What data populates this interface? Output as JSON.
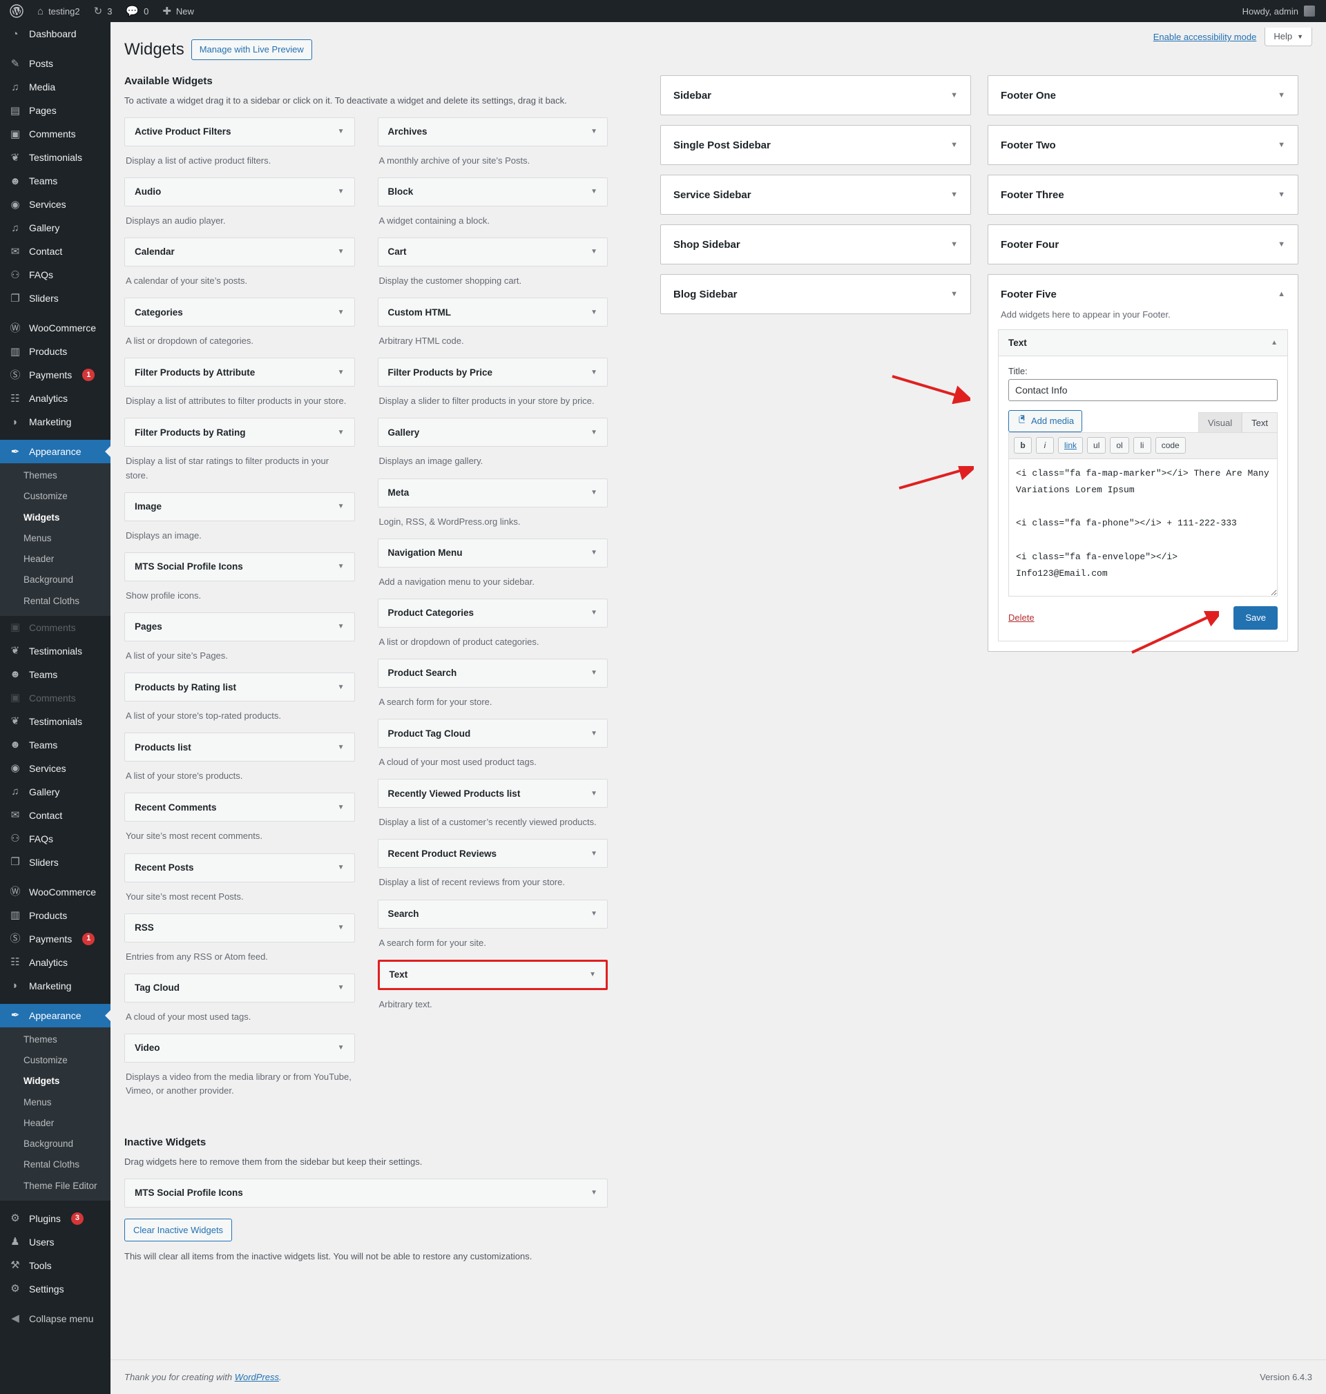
{
  "adminbar": {
    "wp_logo": "wordpress-logo",
    "site_name": "testing2",
    "updates_count": "3",
    "comments_count": "0",
    "new_label": "New",
    "howdy": "Howdy, admin"
  },
  "sidebar": {
    "groups": [
      {
        "items": [
          {
            "label": "Dashboard",
            "icon": "dashboard-icon"
          }
        ]
      },
      {
        "items": [
          {
            "label": "Posts",
            "icon": "pin-icon"
          },
          {
            "label": "Media",
            "icon": "media-icon"
          },
          {
            "label": "Pages",
            "icon": "pages-icon"
          },
          {
            "label": "Comments",
            "icon": "comment-icon"
          },
          {
            "label": "Testimonials",
            "icon": "testimonials-icon"
          },
          {
            "label": "Teams",
            "icon": "teams-icon"
          },
          {
            "label": "Services",
            "icon": "services-icon"
          },
          {
            "label": "Gallery",
            "icon": "gallery-icon"
          },
          {
            "label": "Contact",
            "icon": "envelope-icon"
          },
          {
            "label": "FAQs",
            "icon": "faq-icon"
          },
          {
            "label": "Sliders",
            "icon": "sliders-icon"
          }
        ]
      },
      {
        "items": [
          {
            "label": "WooCommerce",
            "icon": "woocommerce-icon"
          },
          {
            "label": "Products",
            "icon": "products-icon"
          },
          {
            "label": "Payments",
            "icon": "payments-icon",
            "badge": "1"
          },
          {
            "label": "Analytics",
            "icon": "analytics-icon"
          },
          {
            "label": "Marketing",
            "icon": "marketing-icon"
          }
        ]
      }
    ],
    "appearance": {
      "label": "Appearance",
      "icon": "appearance-brush-icon",
      "current": true,
      "submenu": [
        {
          "label": "Themes",
          "current": false
        },
        {
          "label": "Customize",
          "current": false
        },
        {
          "label": "Widgets",
          "current": true
        },
        {
          "label": "Menus",
          "current": false
        },
        {
          "label": "Header",
          "current": false
        },
        {
          "label": "Background",
          "current": false
        },
        {
          "label": "Rental Cloths",
          "current": false
        },
        {
          "label": "Theme File Editor",
          "current": false
        }
      ]
    },
    "appearance_short_submenu": [
      {
        "label": "Themes",
        "current": false
      },
      {
        "label": "Customize",
        "current": false
      },
      {
        "label": "Widgets",
        "current": true
      },
      {
        "label": "Menus",
        "current": false
      },
      {
        "label": "Header",
        "current": false
      },
      {
        "label": "Background",
        "current": false
      },
      {
        "label": "Rental Cloths",
        "current": false
      }
    ],
    "ghost_repeat": [
      {
        "label": "Comments",
        "icon": "comment-icon"
      },
      {
        "label": "Testimonials",
        "icon": "testimonials-icon"
      },
      {
        "label": "Teams",
        "icon": "teams-icon"
      }
    ],
    "bottom_items": [
      {
        "label": "Plugins",
        "icon": "plugins-icon",
        "badge": "3"
      },
      {
        "label": "Users",
        "icon": "users-icon"
      },
      {
        "label": "Tools",
        "icon": "tools-icon"
      },
      {
        "label": "Settings",
        "icon": "settings-icon"
      },
      {
        "label": "Collapse menu",
        "icon": "collapse-icon"
      }
    ]
  },
  "screen_meta": {
    "accessibility_link": "Enable accessibility mode",
    "help_label": "Help"
  },
  "page": {
    "title": "Widgets",
    "live_preview_button": "Manage with Live Preview"
  },
  "available": {
    "heading": "Available Widgets",
    "description": "To activate a widget drag it to a sidebar or click on it. To deactivate a widget and delete its settings, drag it back.",
    "left_column": [
      {
        "name": "Active Product Filters",
        "desc": "Display a list of active product filters."
      },
      {
        "name": "Audio",
        "desc": "Displays an audio player."
      },
      {
        "name": "Calendar",
        "desc": "A calendar of your site’s posts."
      },
      {
        "name": "Categories",
        "desc": "A list or dropdown of categories."
      },
      {
        "name": "Filter Products by Attribute",
        "desc": "Display a list of attributes to filter products in your store."
      },
      {
        "name": "Filter Products by Rating",
        "desc": "Display a list of star ratings to filter products in your store."
      },
      {
        "name": "Image",
        "desc": "Displays an image."
      },
      {
        "name": "MTS Social Profile Icons",
        "desc": "Show profile icons."
      },
      {
        "name": "Pages",
        "desc": "A list of your site’s Pages."
      },
      {
        "name": "Products by Rating list",
        "desc": "A list of your store's top-rated products."
      },
      {
        "name": "Products list",
        "desc": "A list of your store's products."
      },
      {
        "name": "Recent Comments",
        "desc": "Your site’s most recent comments."
      },
      {
        "name": "Recent Posts",
        "desc": "Your site’s most recent Posts."
      },
      {
        "name": "RSS",
        "desc": "Entries from any RSS or Atom feed."
      },
      {
        "name": "Tag Cloud",
        "desc": "A cloud of your most used tags."
      },
      {
        "name": "Video",
        "desc": "Displays a video from the media library or from YouTube, Vimeo, or another provider."
      }
    ],
    "right_column": [
      {
        "name": "Archives",
        "desc": "A monthly archive of your site’s Posts."
      },
      {
        "name": "Block",
        "desc": "A widget containing a block."
      },
      {
        "name": "Cart",
        "desc": "Display the customer shopping cart."
      },
      {
        "name": "Custom HTML",
        "desc": "Arbitrary HTML code."
      },
      {
        "name": "Filter Products by Price",
        "desc": "Display a slider to filter products in your store by price."
      },
      {
        "name": "Gallery",
        "desc": "Displays an image gallery."
      },
      {
        "name": "Meta",
        "desc": "Login, RSS, & WordPress.org links."
      },
      {
        "name": "Navigation Menu",
        "desc": "Add a navigation menu to your sidebar."
      },
      {
        "name": "Product Categories",
        "desc": "A list or dropdown of product categories."
      },
      {
        "name": "Product Search",
        "desc": "A search form for your store."
      },
      {
        "name": "Product Tag Cloud",
        "desc": "A cloud of your most used product tags."
      },
      {
        "name": "Recently Viewed Products list",
        "desc": "Display a list of a customer’s recently viewed products."
      },
      {
        "name": "Recent Product Reviews",
        "desc": "Display a list of recent reviews from your store."
      },
      {
        "name": "Search",
        "desc": "A search form for your site."
      },
      {
        "name": "Text",
        "desc": "Arbitrary text.",
        "highlighted": true
      }
    ]
  },
  "inactive": {
    "heading": "Inactive Widgets",
    "description": "Drag widgets here to remove them from the sidebar but keep their settings.",
    "widget": "MTS Social Profile Icons",
    "clear_button": "Clear Inactive Widgets",
    "clear_note": "This will clear all items from the inactive widgets list. You will not be able to restore any customizations."
  },
  "sidebars_column": [
    {
      "name": "Sidebar"
    },
    {
      "name": "Single Post Sidebar"
    },
    {
      "name": "Service Sidebar"
    },
    {
      "name": "Shop Sidebar"
    },
    {
      "name": "Blog Sidebar"
    }
  ],
  "footers_column": [
    {
      "name": "Footer One"
    },
    {
      "name": "Footer Two"
    },
    {
      "name": "Footer Three"
    },
    {
      "name": "Footer Four"
    }
  ],
  "footer_five": {
    "name": "Footer Five",
    "description": "Add widgets here to appear in your Footer.",
    "widget": {
      "name": "Text",
      "title_label": "Title:",
      "title_value": "Contact Info",
      "add_media_label": "Add media",
      "tabs": [
        {
          "label": "Visual",
          "active": false
        },
        {
          "label": "Text",
          "active": true
        }
      ],
      "quicktags": [
        "b",
        "i",
        "link",
        "ul",
        "ol",
        "li",
        "code"
      ],
      "content_lines": [
        "<i class=\"fa fa-map-marker\"></i> There Are Many Variations Lorem Ipsum",
        "",
        "<i class=\"fa fa-phone\"></i> + 111-222-333",
        "",
        "<i class=\"fa fa-envelope\"></i> Info123@Email.com"
      ],
      "delete_label": "Delete",
      "save_label": "Save"
    }
  },
  "footer": {
    "thanks_prefix": "Thank you for creating with ",
    "thanks_link": "WordPress",
    "thanks_suffix": ".",
    "version": "Version 6.4.3"
  },
  "colors": {
    "accent": "#2271b1",
    "admin_bg": "#1d2327",
    "danger": "#d63638",
    "annotation": "#e02020"
  }
}
